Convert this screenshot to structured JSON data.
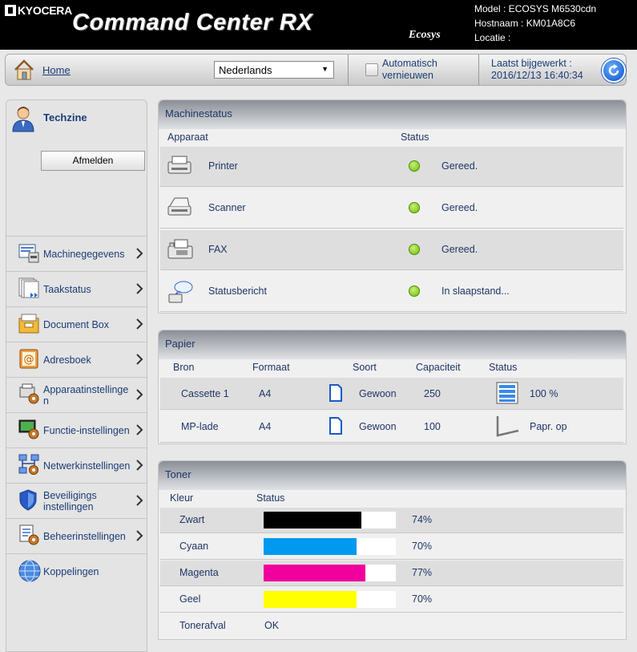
{
  "header": {
    "brand": "KYOCERA",
    "title": "Command Center RX",
    "sub_brand": "Ecosys",
    "model": "Model : ECOSYS M6530cdn",
    "hostname": "Hostnaam : KM01A8C6",
    "location": "Locatie :"
  },
  "nav": {
    "home_label": "Home",
    "language": "Nederlands",
    "auto_refresh_line1": "Automatisch",
    "auto_refresh_line2": "vernieuwen",
    "auto_refresh_checked": false,
    "updated_line1": "Laatst bijgewerkt :",
    "updated_line2": "2016/12/13 16:40:34"
  },
  "sidebar": {
    "user": "Techzine",
    "logout_label": "Afmelden",
    "items": [
      {
        "label1": "Machinegegevens",
        "label2": "",
        "icon": "device-info-icon",
        "chevron": true
      },
      {
        "label1": "Taakstatus",
        "label2": "",
        "icon": "job-status-icon",
        "chevron": true
      },
      {
        "label1": "Document Box",
        "label2": "",
        "icon": "document-box-icon",
        "chevron": true
      },
      {
        "label1": "Adresboek",
        "label2": "",
        "icon": "address-book-icon",
        "chevron": true
      },
      {
        "label1": "Apparaatinstellinge",
        "label2": "n",
        "icon": "device-settings-icon",
        "chevron": true
      },
      {
        "label1": "Functie-instellingen",
        "label2": "",
        "icon": "function-settings-icon",
        "chevron": true
      },
      {
        "label1": "Netwerkinstellingen",
        "label2": "",
        "icon": "network-settings-icon",
        "chevron": true
      },
      {
        "label1": "Beveiligings",
        "label2": "instellingen",
        "icon": "security-settings-icon",
        "chevron": true
      },
      {
        "label1": "Beheerinstellingen",
        "label2": "",
        "icon": "management-settings-icon",
        "chevron": true
      },
      {
        "label1": "Koppelingen",
        "label2": "",
        "icon": "links-icon",
        "chevron": false
      }
    ]
  },
  "machine_status": {
    "title": "Machinestatus",
    "col_device": "Apparaat",
    "col_status": "Status",
    "rows": [
      {
        "device": "Printer",
        "status": "Gereed.",
        "icon": "printer-icon",
        "color": "#6cc000"
      },
      {
        "device": "Scanner",
        "status": "Gereed.",
        "icon": "scanner-icon",
        "color": "#6cc000"
      },
      {
        "device": "FAX",
        "status": "Gereed.",
        "icon": "fax-icon",
        "color": "#6cc000"
      },
      {
        "device": "Statusbericht",
        "status": "In slaapstand...",
        "icon": "status-message-icon",
        "color": "#6cc000"
      }
    ]
  },
  "paper": {
    "title": "Papier",
    "col_source": "Bron",
    "col_format": "Formaat",
    "col_type": "Soort",
    "col_capacity": "Capaciteit",
    "col_status": "Status",
    "rows": [
      {
        "source": "Cassette 1",
        "format": "A4",
        "type": "Gewoon",
        "capacity": "250",
        "status": "100 %",
        "status_icon": "paper-level-full-icon"
      },
      {
        "source": "MP-lade",
        "format": "A4",
        "type": "Gewoon",
        "capacity": "100",
        "status": "Papr. op",
        "status_icon": "paper-empty-icon"
      }
    ]
  },
  "toner": {
    "title": "Toner",
    "col_color": "Kleur",
    "col_status": "Status",
    "rows": [
      {
        "color": "Zwart",
        "percent_label": "74%",
        "level": 0.74,
        "hex": "#000000"
      },
      {
        "color": "Cyaan",
        "percent_label": "70%",
        "level": 0.7,
        "hex": "#0099f0"
      },
      {
        "color": "Magenta",
        "percent_label": "77%",
        "level": 0.77,
        "hex": "#f0009c"
      },
      {
        "color": "Geel",
        "percent_label": "70%",
        "level": 0.7,
        "hex": "#ffff00"
      }
    ],
    "waste_label": "Tonerafval",
    "waste_status": "OK"
  }
}
